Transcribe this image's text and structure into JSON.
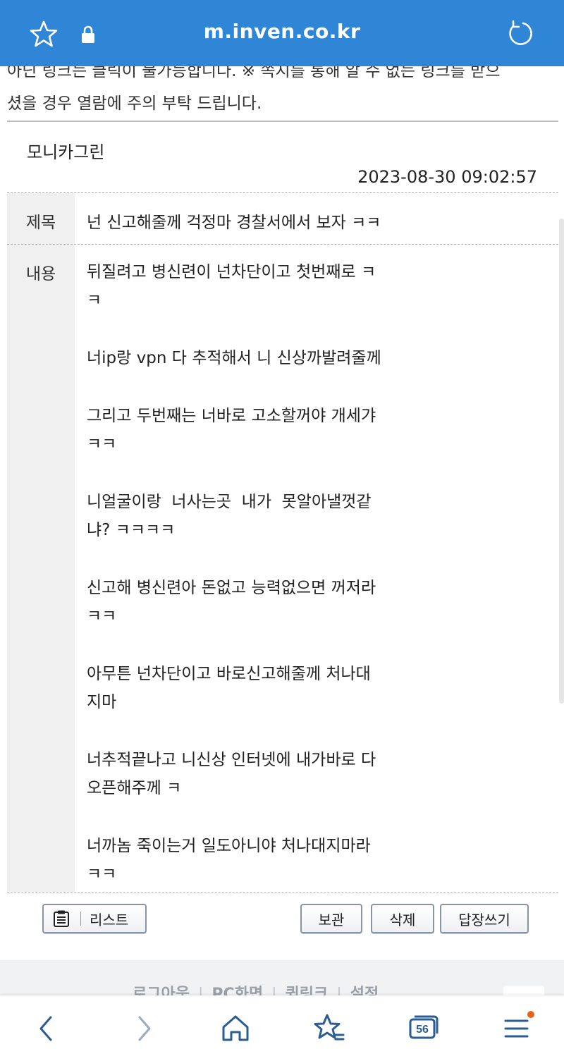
{
  "browser": {
    "url": "m.inven.co.kr"
  },
  "notice": {
    "line1": "아닌 링크는 클릭이 불가능합니다. ※ 쪽지를 통해 알 수 없는 링크를 받으",
    "line2": "셨을 경우 열람에 주의 부탁 드립니다."
  },
  "message": {
    "sender": "모니카그린",
    "date": "2023-08-30 09:02:57",
    "subject_label": "제목",
    "subject": "넌 신고해줄께 걱정마 경찰서에서 보자 ㅋㅋ",
    "content_label": "내용",
    "paragraphs": [
      "뒤질려고 병신련이 넌차단이고 첫번째로 ㅋ\nㅋ",
      "너ip랑 vpn 다 추적해서 니 신상까발려줄께",
      "그리고 두번째는 너바로 고소할꺼야 개세갸\nㅋㅋ",
      "니얼굴이랑  너사는곳  내가  못알아낼껏같\n냐? ㅋㅋㅋㅋ",
      "신고해 병신련아 돈없고 능력없으면 꺼저라\nㅋㅋ",
      "아무튼 넌차단이고 바로신고해줄께 처나대\n지마",
      "너추적끝나고 니신상 인터넷에 내가바로 다\n오픈해주께 ㅋ",
      "너까놈 죽이는거 일도아니야 처나대지마라\nㅋㅋ"
    ]
  },
  "actions": {
    "list": "리스트",
    "keep": "보관",
    "delete": "삭제",
    "reply": "답장쓰기"
  },
  "footer": {
    "logout": "로그아웃",
    "pc": "PC화면",
    "quicklink": "퀵링크",
    "settings": "설정"
  },
  "nav": {
    "tabs_count": "56",
    "menu_badge_color": "#e8631a"
  },
  "colors": {
    "browser_bar": "#2f86d6"
  }
}
